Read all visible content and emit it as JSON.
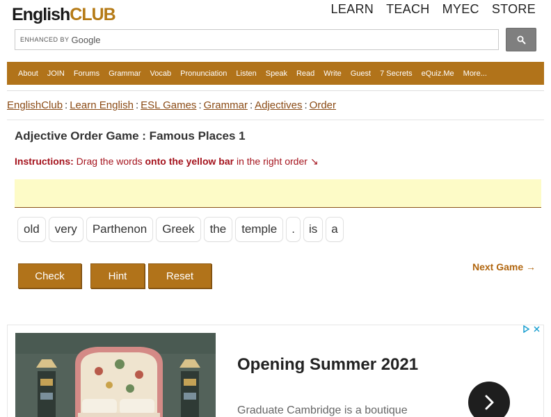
{
  "header": {
    "logo_english": "English",
    "logo_club": "CLUB",
    "nav": [
      "LEARN",
      "TEACH",
      "MYEC",
      "STORE"
    ]
  },
  "search": {
    "enhanced_by": "ENHANCED BY",
    "provider": "Google",
    "value": ""
  },
  "main_nav": [
    "About",
    "JOIN",
    "Forums",
    "Grammar",
    "Vocab",
    "Pronunciation",
    "Listen",
    "Speak",
    "Read",
    "Write",
    "Guest",
    "7 Secrets",
    "eQuiz.Me",
    "More..."
  ],
  "breadcrumb": [
    "EnglishClub",
    "Learn English",
    "ESL Games",
    "Grammar",
    "Adjectives",
    "Order"
  ],
  "breadcrumb_separator": ":",
  "game": {
    "title": "Adjective Order Game : Famous Places 1",
    "instructions_label": "Instructions:",
    "instructions_pre": "Drag the words",
    "instructions_bold": "onto the yellow bar",
    "instructions_post": "in the right order",
    "instructions_arrow": "↘",
    "words": [
      "old",
      "very",
      "Parthenon",
      "Greek",
      "the",
      "temple",
      ".",
      "is",
      "a"
    ],
    "buttons": {
      "check": "Check",
      "hint": "Hint",
      "reset": "Reset"
    },
    "next_game": "Next Game →"
  },
  "ad": {
    "title": "Opening Summer 2021",
    "description": "Graduate Cambridge is a boutique",
    "choices_icon": "adchoices-icon",
    "close_icon": "close-icon",
    "arrow_icon": "chevron-right-icon"
  },
  "colors": {
    "brand_brown": "#b1731a",
    "logo_gold": "#b57a15",
    "instruction_red": "#a5141e",
    "drop_bar_yellow": "#fdfbc7",
    "link_brown": "#8a4a14"
  }
}
